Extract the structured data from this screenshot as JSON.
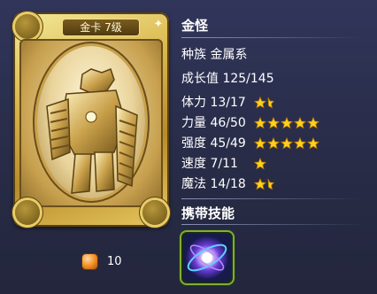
{
  "card": {
    "grade_label": "金卡 7级"
  },
  "monster": {
    "name": "金怪",
    "race": "种族  金属系",
    "growth": "成长值 125/145"
  },
  "stats": [
    {
      "label": "体力 13/17",
      "stars_full": 1,
      "stars_half": 1
    },
    {
      "label": "力量 46/50",
      "stars_full": 5,
      "stars_half": 0
    },
    {
      "label": "强度 45/49",
      "stars_full": 5,
      "stars_half": 0
    },
    {
      "label": "速度 7/11",
      "stars_full": 1,
      "stars_half": 0
    },
    {
      "label": "魔法 14/18",
      "stars_full": 1,
      "stars_half": 1
    }
  ],
  "skills_title": "携带技能",
  "price": "10",
  "colors": {
    "star": "#ffd21f",
    "star_stroke": "#b07400",
    "skill_border": "#7fae3a"
  }
}
